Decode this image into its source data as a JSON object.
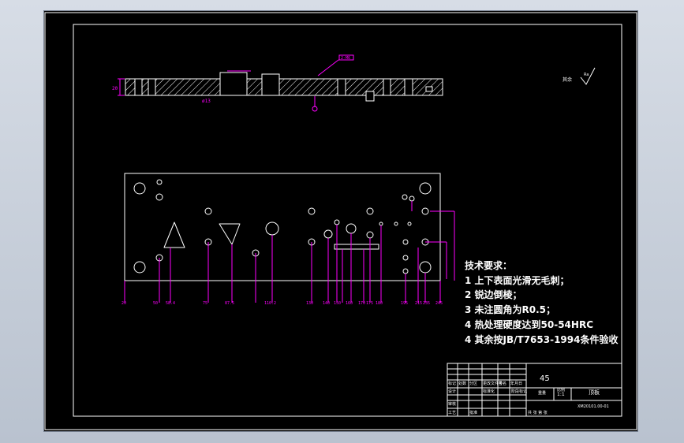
{
  "drawing": {
    "material": "45",
    "part_name": "顶板",
    "drawing_no": "XM20101.00-01",
    "roughness_symbol": "Ra",
    "roughness_label": "其余"
  },
  "requirements": {
    "heading": "技术要求：",
    "items": [
      "1  上下表面光滑无毛刺；",
      "2  锐边倒棱；",
      "3  未注圆角为R0.5；",
      "4  热处理硬度达到50-54HRC",
      "4  其余按JB/T7653-1994条件验收"
    ]
  },
  "section_view": {
    "callout_label": "2-M6",
    "dim_left": "20",
    "dim_mid": "ø13"
  },
  "plan_view": {
    "dimensions": [
      "20",
      "50",
      "58.4",
      "75",
      "87.5",
      "110.2",
      "130",
      "140",
      "150",
      "160",
      "170",
      "175",
      "180",
      "195",
      "215",
      "235",
      "245"
    ]
  },
  "title_block": {
    "row1": [
      "标记",
      "处数",
      "分区",
      "更改文件号",
      "签名",
      "年月日"
    ],
    "row2": [
      "设计",
      "",
      "标准化",
      "",
      "阶段标记",
      "重量",
      "比例"
    ],
    "row3": [
      "审核",
      "",
      "",
      "",
      "",
      "",
      ""
    ],
    "row4": [
      "工艺",
      "",
      "批准",
      "",
      "共  张  第  张"
    ],
    "scale": "1:1"
  },
  "colors": {
    "geometry": "#ffffff",
    "dimension": "#ff00ff",
    "background": "#000000",
    "frame": "#ffffff"
  }
}
